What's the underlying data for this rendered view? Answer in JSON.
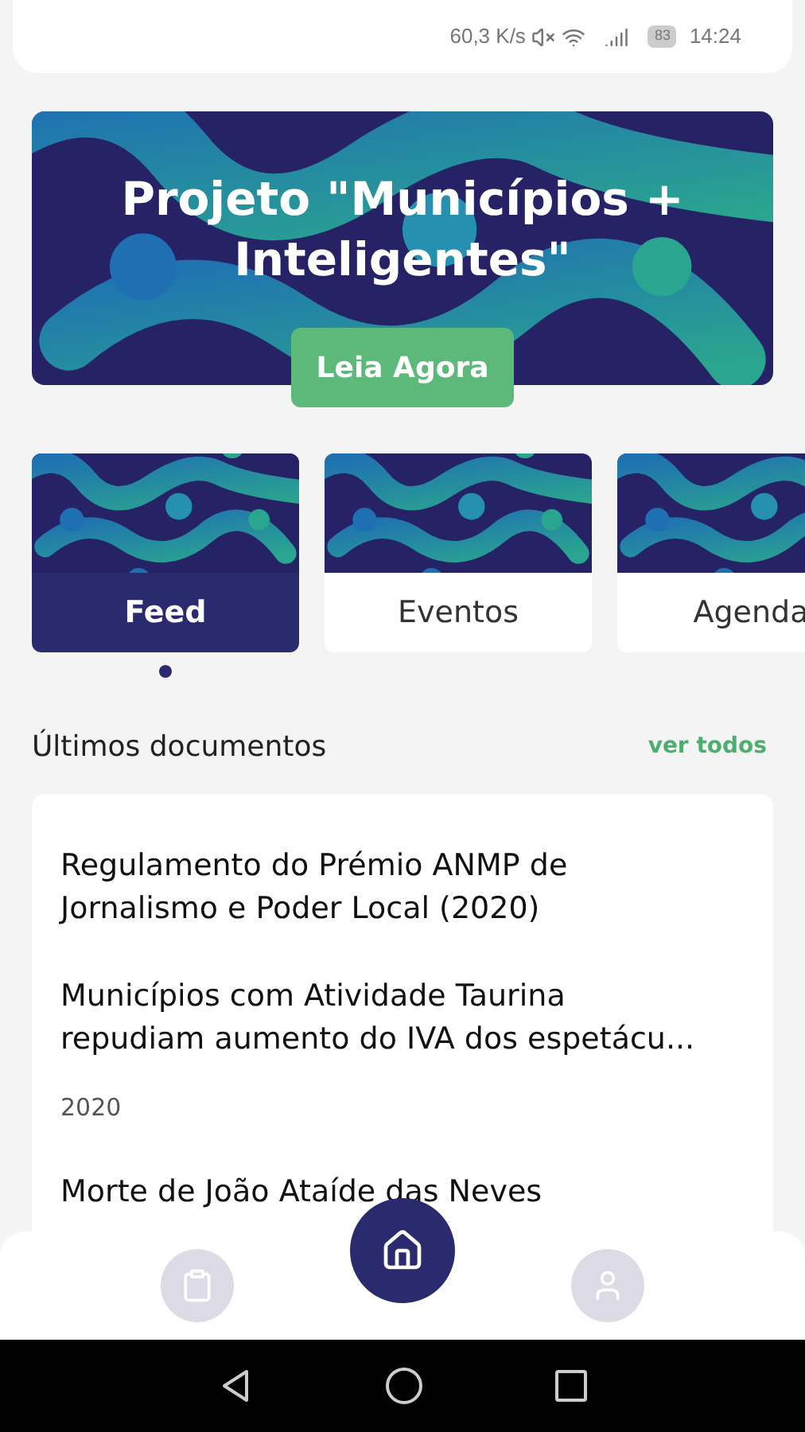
{
  "status_bar": {
    "speed": "60,3 K/s",
    "battery": "83",
    "time": "14:24"
  },
  "banner": {
    "title": "Projeto \"Municípios + Inteligentes\"",
    "button": "Leia Agora"
  },
  "tabs": [
    {
      "label": "Feed",
      "selected": true
    },
    {
      "label": "Eventos",
      "selected": false
    },
    {
      "label": "Agenda",
      "selected": false
    }
  ],
  "documents": {
    "heading": "Últimos documentos",
    "link": "ver todos",
    "items": [
      {
        "title": "Regulamento do Prémio ANMP de Jornalismo e Poder Local (2020)"
      },
      {
        "title": "Municípios com Atividade Taurina repudiam aumento do IVA dos espetácu...",
        "year": "2020"
      },
      {
        "title": "Morte de João Ataíde das Neves"
      }
    ]
  },
  "bottom_nav": [
    {
      "kind": "documents",
      "selected": false
    },
    {
      "kind": "home",
      "selected": true
    },
    {
      "kind": "profile",
      "selected": false
    }
  ]
}
